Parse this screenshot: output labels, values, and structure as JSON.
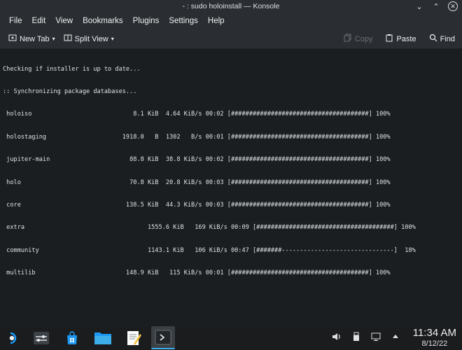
{
  "window": {
    "title": "- : sudo holoinstall — Konsole"
  },
  "menu": {
    "items": [
      "File",
      "Edit",
      "View",
      "Bookmarks",
      "Plugins",
      "Settings",
      "Help"
    ]
  },
  "toolbar": {
    "new_tab": "New Tab",
    "split_view": "Split View",
    "copy": "Copy",
    "paste": "Paste",
    "find": "Find"
  },
  "terminal": {
    "lines": [
      "Checking if installer is up to date...",
      ":: Synchronizing package databases...",
      " holoiso                            8.1 KiB  4.64 KiB/s 00:02 [######################################] 100%",
      " holostaging                     1918.0   B  1302   B/s 00:01 [######################################] 100%",
      " jupiter-main                      88.8 KiB  38.8 KiB/s 00:02 [######################################] 100%",
      " holo                              70.8 KiB  20.8 KiB/s 00:03 [######################################] 100%",
      " core                             138.5 KiB  44.3 KiB/s 00:03 [######################################] 100%",
      " extra                                  1555.6 KiB   169 KiB/s 00:09 [######################################] 100%",
      " community                              1143.1 KiB   106 KiB/s 00:47 [#######-------------------------------]  18%",
      " multilib                         148.9 KiB   115 KiB/s 00:01 [######################################] 100%"
    ]
  },
  "taskbar": {
    "time": "11:34 AM",
    "date": "8/12/22"
  },
  "colors": {
    "accent": "#3daee9",
    "terminal_bg": "#1b1e20",
    "chrome_bg": "#2a2e32"
  }
}
